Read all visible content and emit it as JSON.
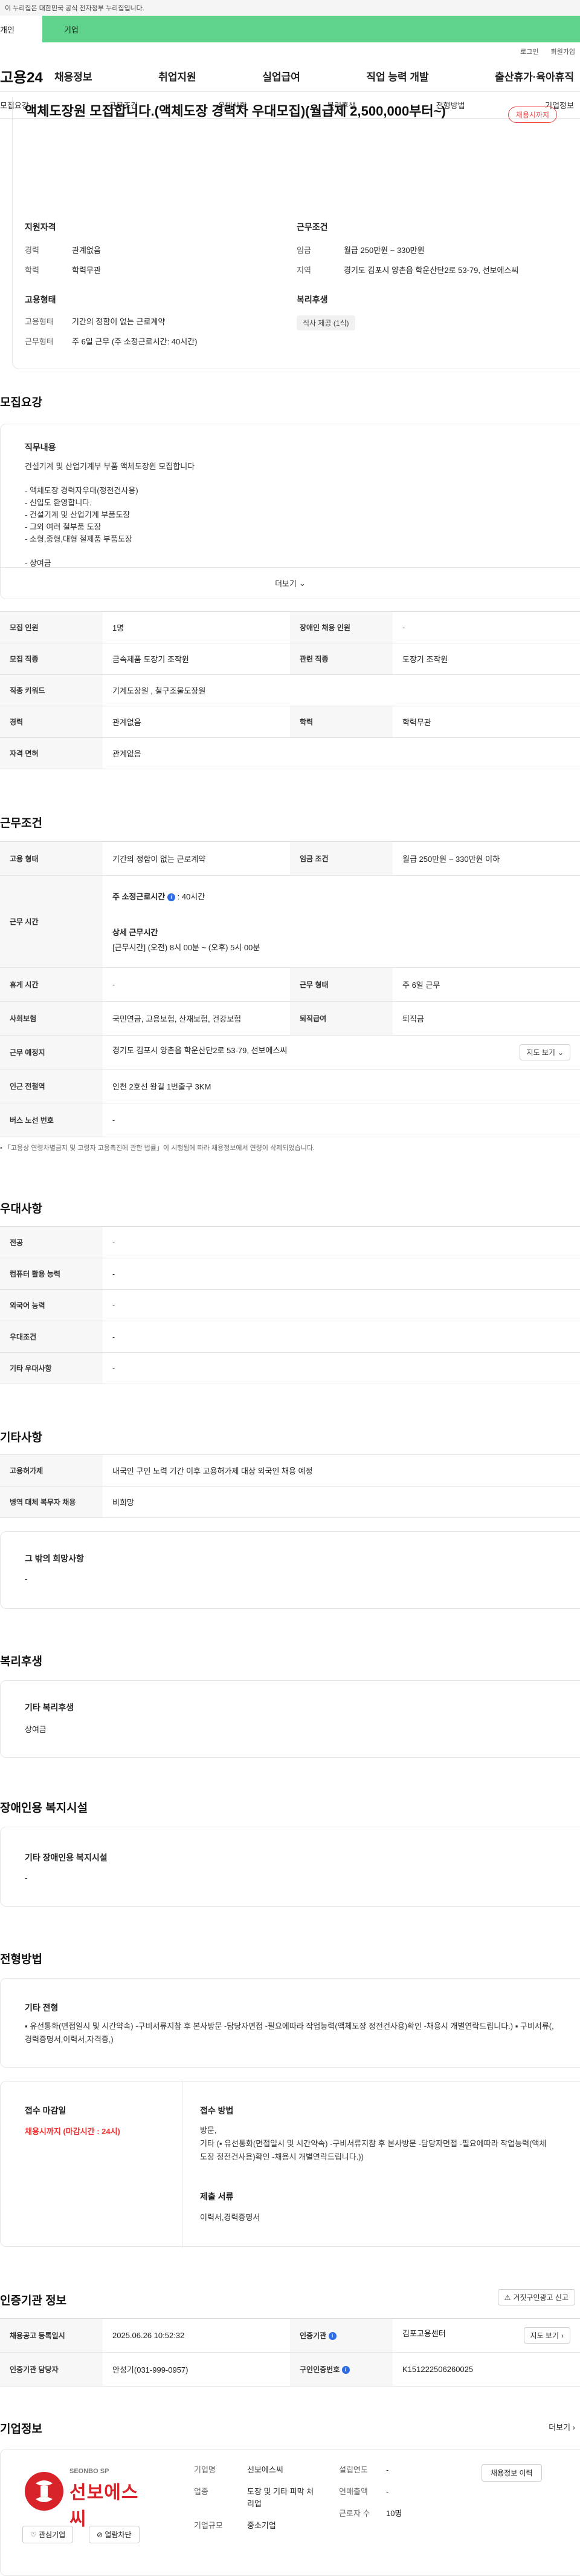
{
  "gov_banner": "이 누리집은 대한민국 공식 전자정부 누리집입니다.",
  "user_tabs": {
    "personal": "개인",
    "company": "기업"
  },
  "util": {
    "login": "로그인",
    "join": "회원가입"
  },
  "logo": "고용24",
  "gnb": [
    "채용정보",
    "취업지원",
    "실업급여",
    "직업 능력 개발",
    "출산휴가·육아휴직"
  ],
  "anchor_nav": [
    "모집요강",
    "근무조건",
    "우대사항",
    "복리후생",
    "전형방법",
    "기업정보"
  ],
  "summary": {
    "title": "액체도장원 모집합니다.(액체도장 경력자 우대모집)(월급제 2,500,000부터~)",
    "status": "채용시까지",
    "qualification_title": "지원자격",
    "career_label": "경력",
    "career_value": "관계없음",
    "education_label": "학력",
    "education_value": "학력무관",
    "conditions_title": "근무조건",
    "wage_label": "임금",
    "wage_value": "월급 250만원 ~ 330만원",
    "region_label": "지역",
    "region_value": "경기도 김포시 양촌읍 학운산단2로 53-79, 선보에스씨",
    "employment_title": "고용형태",
    "emp_type_label": "고용형태",
    "emp_type_value": "기간의 정함이 없는 근로계약",
    "work_form_label": "근무형태",
    "work_form_value": "주 6일 근무 (주 소정근로시간: 40시간)",
    "welfare_title": "복리후생",
    "welfare_chip": "식사 제공 (1식)"
  },
  "recruit": {
    "section_title": "모집요강",
    "duty_title": "직무내용",
    "duty_text": "건설기계 및 산업기계부 부품 액체도장원 모집합니다\n\n- 액체도장 경력자우대(정전건사용)\n- 신입도 환영합니다.\n- 건설기계 및 산업기계 부품도장\n- 그외 여러 철부품 도장\n- 소형,중형,대형 철제품 부품도장\n\n- 상여금",
    "more_label": "더보기",
    "rows": [
      {
        "k1": "모집 인원",
        "v1": "1명",
        "k2": "장애인 채용 인원",
        "v2": "-"
      },
      {
        "k1": "모집 직종",
        "v1": "금속제품 도장기 조작원",
        "k2": "관련 직종",
        "v2": "도장기 조작원"
      },
      {
        "k1": "직종 키워드",
        "v1": "기계도장원 , 철구조물도장원"
      },
      {
        "k1": "경력",
        "v1": "관계없음",
        "k2": "학력",
        "v2": "학력무관"
      },
      {
        "k1": "자격 면허",
        "v1": "관계없음"
      }
    ]
  },
  "work": {
    "section_title": "근무조건",
    "emp_type_label": "고용 형태",
    "emp_type_value": "기간의 정함이 없는 근로계약",
    "wage_label": "임금 조건",
    "wage_value": "월급 250만원 ~ 330만원 이하",
    "hours_label": "근무 시간",
    "hours_weekly": "주 소정근로시간",
    "hours_weekly_value": ": 40시간",
    "hours_detail_title": "상세 근무시간",
    "hours_detail_value": "[근무시간] (오전) 8시 00분 ~ (오후) 5시 00분",
    "break_label": "휴게 시간",
    "break_value": "-",
    "form_label": "근무 형태",
    "form_value": "주 6일 근무",
    "insurance_label": "사회보험",
    "insurance_value": "국민연금, 고용보험, 산재보험, 건강보험",
    "retire_label": "퇴직급여",
    "retire_value": "퇴직금",
    "place_label": "근무 예정지",
    "place_value": "경기도 김포시 양촌읍 학운산단2로 53-79, 선보에스씨",
    "map_btn": "지도 보기",
    "subway_label": "인근 전철역",
    "subway_value": "인천 2호선 왕길 1번출구 3KM",
    "bus_label": "버스 노선 번호",
    "bus_value": "-",
    "note": "「고용상 연령차별금지 및 고령자 고용촉진에 관한 법률」이 시행됨에 따라 채용정보에서 연령이 삭제되었습니다."
  },
  "prefer": {
    "section_title": "우대사항",
    "rows": [
      {
        "k": "전공",
        "v": "-"
      },
      {
        "k": "컴퓨터 활용 능력",
        "v": "-"
      },
      {
        "k": "외국어 능력",
        "v": "-"
      },
      {
        "k": "우대조건",
        "v": "-"
      },
      {
        "k": "기타 우대사항",
        "v": "-"
      }
    ]
  },
  "etc": {
    "section_title": "기타사항",
    "rows": [
      {
        "k": "고용허가제",
        "v": "내국인 구인 노력 기간 이후 고용허가제 대상 외국인 채용 예정"
      },
      {
        "k": "병역 대체 복무자 채용",
        "v": "비희망"
      }
    ],
    "wish_title": "그 밖의 희망사항",
    "wish_value": "-"
  },
  "welfare": {
    "section_title": "복리후생",
    "box_title": "기타 복리후생",
    "box_value": "상여금"
  },
  "disabled": {
    "section_title": "장애인용 복지시설",
    "box_title": "기타 장애인용 복지시설",
    "box_value": "-"
  },
  "screening": {
    "section_title": "전형방법",
    "box_title": "기타 전형",
    "box_value": "▪ 유선통화(면접일시 및 시간약속) -구비서류지참 후 본사방문 -담당자면접 -필요에따라 작업능력(액체도장 정전건사용)확인 -채용시 개별연락드립니다.) ▪ 구비서류(,경력증명서,이력서,자격증,)",
    "deadline_title": "접수 마감일",
    "deadline_value": "채용시까지 (마감시간 : 24시)",
    "method_title": "접수 방법",
    "method_value": "방문,\n기타 (▪ 유선통화(면접일시 및 시간약속) -구비서류지참 후 본사방문 -담당자면접 -필요에따라 작업능력(액체도장 정전건사용)확인 -채용시 개별연락드립니다.))",
    "docs_title": "제출 서류",
    "docs_value": "이력서,경력증명서"
  },
  "agency": {
    "section_title": "인증기관 정보",
    "report_btn": "거짓구인광고 신고",
    "reg_label": "채용공고 등록일시",
    "reg_value": "2025.06.26 10:52:32",
    "agency_label": "인증기관",
    "agency_value": "김포고용센터",
    "map_btn": "지도 보기",
    "manager_label": "인증기관 담당자",
    "manager_value": "안성기(031-999-0957)",
    "auth_label": "구인인증번호",
    "auth_value": "K151222506260025"
  },
  "company": {
    "section_title": "기업정보",
    "more": "더보기",
    "logo_text": "선보에스씨",
    "logo_sub": "SEONBO SP",
    "interest_btn": "관심기업",
    "block_btn": "열람차단",
    "name_label": "기업명",
    "name_value": "선보에스씨",
    "industry_label": "업종",
    "industry_value": "도장 및 기타 피막 처리업",
    "size_label": "기업규모",
    "size_value": "중소기업",
    "founded_label": "설립연도",
    "founded_value": "-",
    "revenue_label": "연매출액",
    "revenue_value": "-",
    "employees_label": "근로자 수",
    "employees_value": "10명",
    "jobs_btn": "채용정보 이력"
  },
  "colors": {
    "brand_green": "#5fd38b",
    "accent_red": "#e44444",
    "info_blue": "#2c6ae6"
  }
}
